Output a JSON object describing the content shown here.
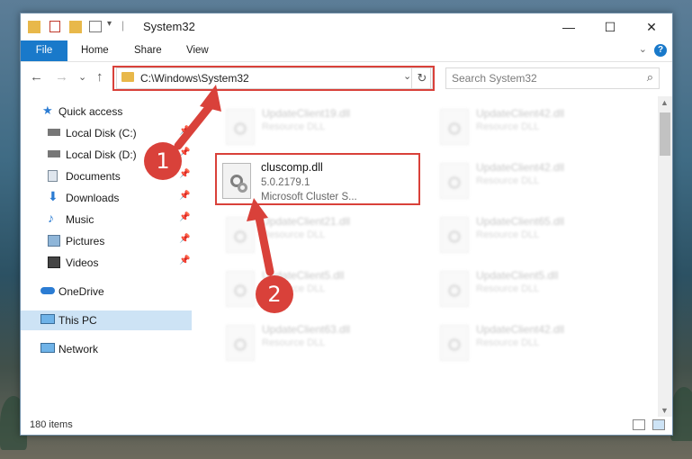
{
  "window": {
    "title": "System32",
    "minimize_glyph": "—",
    "maximize_glyph": "☐",
    "close_glyph": "✕"
  },
  "ribbon": {
    "tabs": [
      "File",
      "Home",
      "Share",
      "View"
    ],
    "collapse_glyph": "⌄",
    "help_glyph": "?"
  },
  "nav": {
    "back_glyph": "←",
    "forward_glyph": "→",
    "recent_glyph": "⌄",
    "up_glyph": "↑",
    "address": "C:\\Windows\\System32",
    "address_dropdown_glyph": "⌄",
    "refresh_glyph": "↻",
    "search_placeholder": "Search System32",
    "search_glyph": "⌕"
  },
  "sidebar": {
    "items": [
      {
        "label": "Quick access",
        "icon": "star-icon"
      },
      {
        "label": "Local Disk (C:)",
        "icon": "drive-icon"
      },
      {
        "label": "Local Disk (D:)",
        "icon": "drive-icon"
      },
      {
        "label": "Documents",
        "icon": "documents-icon"
      },
      {
        "label": "Downloads",
        "icon": "download-icon"
      },
      {
        "label": "Music",
        "icon": "music-icon"
      },
      {
        "label": "Pictures",
        "icon": "pictures-icon"
      },
      {
        "label": "Videos",
        "icon": "videos-icon"
      },
      {
        "label": "OneDrive",
        "icon": "cloud-icon"
      },
      {
        "label": "This PC",
        "icon": "computer-icon"
      },
      {
        "label": "Network",
        "icon": "network-icon"
      }
    ],
    "pin_glyph": "📌"
  },
  "files": {
    "focused": {
      "name": "cluscomp.dll",
      "version": "5.0.2179.1",
      "description": "Microsoft Cluster S..."
    },
    "blurred": [
      {
        "name": "UpdateClient19.dll",
        "desc": "Resource DLL"
      },
      {
        "name": "UpdateClient42.dll",
        "desc": "Resource DLL"
      },
      {
        "name": "UpdateClient42.dll",
        "desc": "Resource DLL"
      },
      {
        "name": "UpdateClient21.dll",
        "desc": "Resource DLL"
      },
      {
        "name": "UpdateClient65.dll",
        "desc": "Resource DLL"
      },
      {
        "name": "UpdateClient5.dll",
        "desc": "Resource DLL"
      },
      {
        "name": "UpdateClient5.dll",
        "desc": "Resource DLL"
      },
      {
        "name": "UpdateClient63.dll",
        "desc": "Resource DLL"
      },
      {
        "name": "UpdateClient42.dll",
        "desc": "Resource DLL"
      }
    ]
  },
  "status": {
    "item_count": "180 items"
  },
  "annotations": {
    "marker1": "1",
    "marker2": "2",
    "color": "#d9413a"
  }
}
